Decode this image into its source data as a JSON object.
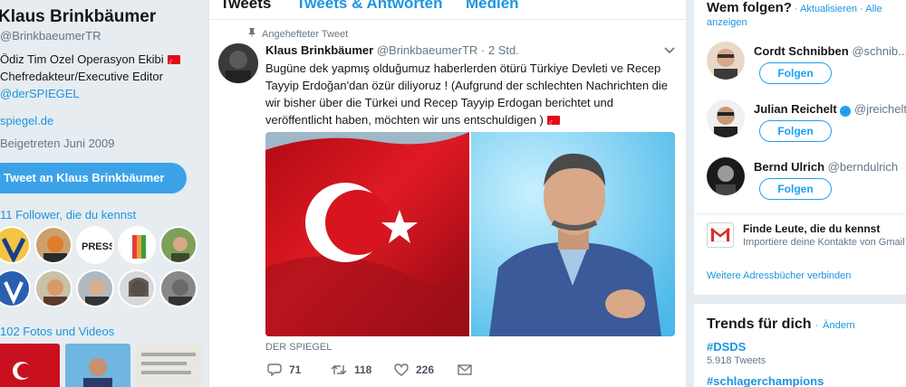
{
  "profile": {
    "name": "Klaus Brinkbäumer",
    "handle": "@BrinkbaeumerTR",
    "bio_line1": "Ödiz Tim Ozel Operasyon Ekibi",
    "bio_line2": "Chefredakteur/Executive Editor",
    "bio_line3": "@derSPIEGEL",
    "website": "spiegel.de",
    "joined": "Beigetreten Juni 2009",
    "tweet_to_button": "Tweet an Klaus Brinkbäumer",
    "followers_you_know": "11 Follower, die du kennst",
    "photos_videos": "102 Fotos und Videos"
  },
  "tabs": [
    "Tweets",
    "Tweets & Antworten",
    "Medien"
  ],
  "tweet": {
    "pinned_label": "Angehefteter Tweet",
    "display_name": "Klaus Brinkbäumer",
    "handle": "@BrinkbaeumerTR",
    "time": "2 Std.",
    "text": "Bugüne dek yapmış olduğumuz haberlerden ötürü Türkiye Devleti ve Recep Tayyip Erdoğan'dan özür diliyoruz ! (Aufgrund der schlechten Nachrichten die wir bisher über die Türkei und Recep Tayyip Erdogan berichtet und veröffentlicht haben, möchten wir uns entschuldigen )",
    "source": "DER SPIEGEL",
    "replies": "71",
    "retweets": "118",
    "likes": "226"
  },
  "sidebar": {
    "who_to_follow_title": "Wem folgen?",
    "refresh": "Aktualisieren",
    "all": "Alle anzeigen",
    "follow_label": "Folgen",
    "suggestions": [
      {
        "name": "Cordt Schnibben",
        "handle": "@schnib..."
      },
      {
        "name": "Julian Reichelt",
        "handle": "@jreichelt"
      },
      {
        "name": "Bernd Ulrich",
        "handle": "@berndulrich"
      }
    ],
    "find_people_title": "Finde Leute, die du kennst",
    "find_people_sub": "Importiere deine Kontakte von Gmail",
    "connect_books": "Weitere Adressbücher verbinden",
    "trends_title": "Trends für dich",
    "trends_change": "Ändern",
    "trends": [
      {
        "tag": "#DSDS",
        "count": "5.918 Tweets"
      },
      {
        "tag": "#schlagerchampions",
        "count": ""
      }
    ]
  },
  "colors": {
    "link": "#1b95e0",
    "accent": "#1da1f2",
    "background": "#e6ecf0",
    "turkey_red": "#e30a17"
  }
}
